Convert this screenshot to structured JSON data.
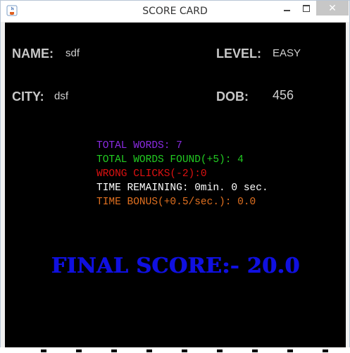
{
  "window": {
    "title": "SCORE CARD",
    "close_glyph": "✕"
  },
  "player": {
    "name_label": "NAME:",
    "name_value": "sdf",
    "level_label": "LEVEL:",
    "level_value": "EASY",
    "city_label": "CITY:",
    "city_value": "dsf",
    "dob_label": "DOB:",
    "dob_value": "456"
  },
  "stats": {
    "total_words": "TOTAL WORDS: 7",
    "total_words_found": "TOTAL WORDS FOUND(+5): 4",
    "wrong_clicks": "WRONG CLICKS(-2):0",
    "time_remaining": "TIME REMAINING: 0min. 0 sec.",
    "time_bonus": "TIME BONUS(+0.5/sec.): 0.0"
  },
  "final_score": "FINAL SCORE:- 20.0",
  "colors": {
    "total_words": "#8a2be2",
    "total_words_found": "#22cc22",
    "wrong_clicks": "#dd1111",
    "time_remaining": "#ffffff",
    "time_bonus": "#e07020",
    "final_score": "#1010e0"
  }
}
